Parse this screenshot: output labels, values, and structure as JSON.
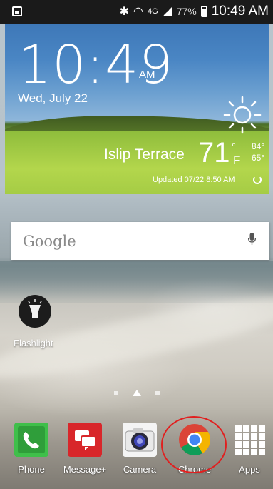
{
  "status_bar": {
    "signal_text": "4G",
    "battery_percent": "77%",
    "time": "10:49 AM"
  },
  "weather_widget": {
    "time": "10:49",
    "ampm": "AM",
    "date": "Wed, July 22",
    "location": "Islip Terrace",
    "temperature": "71",
    "degree": "°",
    "unit": "F",
    "high": "84°",
    "low": "65°",
    "updated": "Updated 07/22 8:50 AM"
  },
  "search_bar": {
    "label": "Google"
  },
  "widgets": {
    "flashlight_label": "Flashlight"
  },
  "dock": {
    "items": [
      {
        "label": "Phone"
      },
      {
        "label": "Message+"
      },
      {
        "label": "Camera"
      },
      {
        "label": "Chrome"
      },
      {
        "label": "Apps"
      }
    ]
  },
  "colors": {
    "highlight_circle": "#e11f1f",
    "phone_green": "#3fbf4a",
    "message_red": "#d8262a"
  }
}
